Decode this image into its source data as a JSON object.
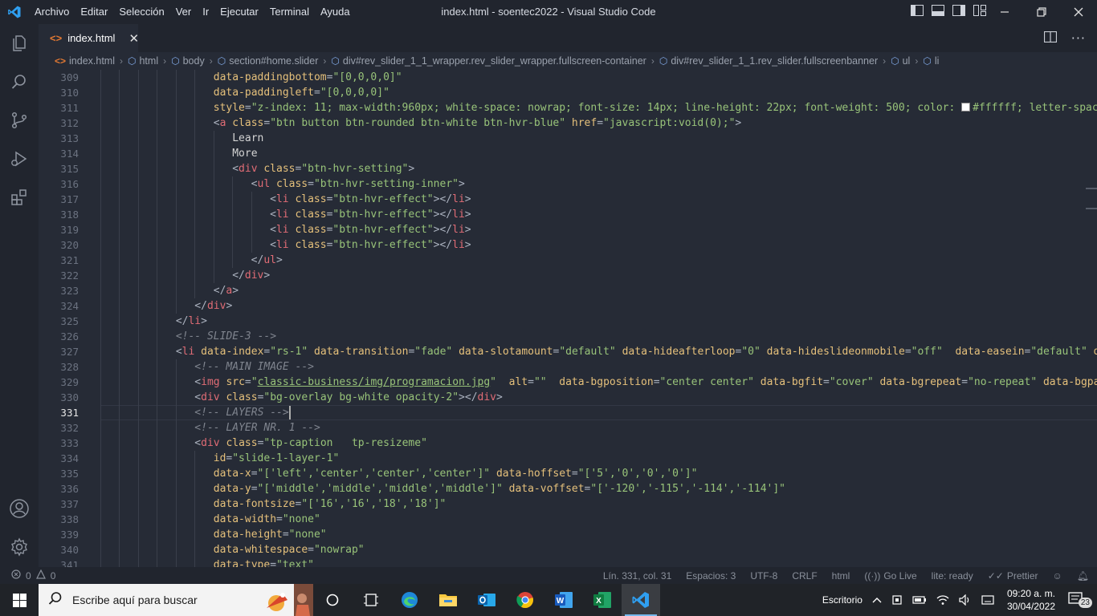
{
  "titlebar": {
    "menu": [
      "Archivo",
      "Editar",
      "Selección",
      "Ver",
      "Ir",
      "Ejecutar",
      "Terminal",
      "Ayuda"
    ],
    "window_title": "index.html - soentec2022 - Visual Studio Code"
  },
  "tab": {
    "label": "index.html",
    "icon_glyph": "<>"
  },
  "breadcrumb": [
    "index.html",
    "html",
    "body",
    "section#home.slider",
    "div#rev_slider_1_1_wrapper.rev_slider_wrapper.fullscreen-container",
    "div#rev_slider_1_1.rev_slider.fullscreenbanner",
    "ul",
    "li"
  ],
  "editor": {
    "first_line": 309,
    "active_line": 331,
    "lines": [
      [
        [
          "t-attr",
          "data-paddingbottom"
        ],
        [
          "t-brk",
          "="
        ],
        [
          "t-str",
          "\"[0,0,0,0]\""
        ]
      ],
      [
        [
          "t-attr",
          "data-paddingleft"
        ],
        [
          "t-brk",
          "="
        ],
        [
          "t-str",
          "\"[0,0,0,0]\""
        ]
      ],
      [
        [
          "t-attr",
          "style"
        ],
        [
          "t-brk",
          "="
        ],
        [
          "t-str",
          "\"z-index: 11; max-width:960px; white-space: nowrap; font-size: 14px; line-height: 22px; font-weight: 500; color: "
        ],
        [
          "swatch",
          ""
        ],
        [
          "t-str",
          "#ffffff; letter-spacing"
        ]
      ],
      [
        [
          "t-brk",
          "<"
        ],
        [
          "t-tag",
          "a"
        ],
        [
          "t-txt",
          " "
        ],
        [
          "t-attr",
          "class"
        ],
        [
          "t-brk",
          "="
        ],
        [
          "t-str",
          "\"btn button btn-rounded btn-white btn-hvr-blue\""
        ],
        [
          "t-txt",
          " "
        ],
        [
          "t-attr",
          "href"
        ],
        [
          "t-brk",
          "="
        ],
        [
          "t-str",
          "\"javascript:void(0);\""
        ],
        [
          "t-brk",
          ">"
        ]
      ],
      [
        [
          "t-txt",
          "Learn"
        ]
      ],
      [
        [
          "t-txt",
          "More"
        ]
      ],
      [
        [
          "t-brk",
          "<"
        ],
        [
          "t-tag",
          "div"
        ],
        [
          "t-txt",
          " "
        ],
        [
          "t-attr",
          "class"
        ],
        [
          "t-brk",
          "="
        ],
        [
          "t-str",
          "\"btn-hvr-setting\""
        ],
        [
          "t-brk",
          ">"
        ]
      ],
      [
        [
          "t-brk",
          "<"
        ],
        [
          "t-tag",
          "ul"
        ],
        [
          "t-txt",
          " "
        ],
        [
          "t-attr",
          "class"
        ],
        [
          "t-brk",
          "="
        ],
        [
          "t-str",
          "\"btn-hvr-setting-inner\""
        ],
        [
          "t-brk",
          ">"
        ]
      ],
      [
        [
          "t-brk",
          "<"
        ],
        [
          "t-tag",
          "li"
        ],
        [
          "t-txt",
          " "
        ],
        [
          "t-attr",
          "class"
        ],
        [
          "t-brk",
          "="
        ],
        [
          "t-str",
          "\"btn-hvr-effect\""
        ],
        [
          "t-brk",
          "></"
        ],
        [
          "t-tag",
          "li"
        ],
        [
          "t-brk",
          ">"
        ]
      ],
      [
        [
          "t-brk",
          "<"
        ],
        [
          "t-tag",
          "li"
        ],
        [
          "t-txt",
          " "
        ],
        [
          "t-attr",
          "class"
        ],
        [
          "t-brk",
          "="
        ],
        [
          "t-str",
          "\"btn-hvr-effect\""
        ],
        [
          "t-brk",
          "></"
        ],
        [
          "t-tag",
          "li"
        ],
        [
          "t-brk",
          ">"
        ]
      ],
      [
        [
          "t-brk",
          "<"
        ],
        [
          "t-tag",
          "li"
        ],
        [
          "t-txt",
          " "
        ],
        [
          "t-attr",
          "class"
        ],
        [
          "t-brk",
          "="
        ],
        [
          "t-str",
          "\"btn-hvr-effect\""
        ],
        [
          "t-brk",
          "></"
        ],
        [
          "t-tag",
          "li"
        ],
        [
          "t-brk",
          ">"
        ]
      ],
      [
        [
          "t-brk",
          "<"
        ],
        [
          "t-tag",
          "li"
        ],
        [
          "t-txt",
          " "
        ],
        [
          "t-attr",
          "class"
        ],
        [
          "t-brk",
          "="
        ],
        [
          "t-str",
          "\"btn-hvr-effect\""
        ],
        [
          "t-brk",
          "></"
        ],
        [
          "t-tag",
          "li"
        ],
        [
          "t-brk",
          ">"
        ]
      ],
      [
        [
          "t-brk",
          "</"
        ],
        [
          "t-tag",
          "ul"
        ],
        [
          "t-brk",
          ">"
        ]
      ],
      [
        [
          "t-brk",
          "</"
        ],
        [
          "t-tag",
          "div"
        ],
        [
          "t-brk",
          ">"
        ]
      ],
      [
        [
          "t-brk",
          "</"
        ],
        [
          "t-tag",
          "a"
        ],
        [
          "t-brk",
          ">"
        ]
      ],
      [
        [
          "t-brk",
          "</"
        ],
        [
          "t-tag",
          "div"
        ],
        [
          "t-brk",
          ">"
        ]
      ],
      [
        [
          "t-brk",
          "</"
        ],
        [
          "t-tag",
          "li"
        ],
        [
          "t-brk",
          ">"
        ]
      ],
      [
        [
          "t-cmt",
          "<!-- SLIDE-3 -->"
        ]
      ],
      [
        [
          "t-brk",
          "<"
        ],
        [
          "t-tag",
          "li"
        ],
        [
          "t-txt",
          " "
        ],
        [
          "t-attr",
          "data-index"
        ],
        [
          "t-brk",
          "="
        ],
        [
          "t-str",
          "\"rs-1\""
        ],
        [
          "t-txt",
          " "
        ],
        [
          "t-attr",
          "data-transition"
        ],
        [
          "t-brk",
          "="
        ],
        [
          "t-str",
          "\"fade\""
        ],
        [
          "t-txt",
          " "
        ],
        [
          "t-attr",
          "data-slotamount"
        ],
        [
          "t-brk",
          "="
        ],
        [
          "t-str",
          "\"default\""
        ],
        [
          "t-txt",
          " "
        ],
        [
          "t-attr",
          "data-hideafterloop"
        ],
        [
          "t-brk",
          "="
        ],
        [
          "t-str",
          "\"0\""
        ],
        [
          "t-txt",
          " "
        ],
        [
          "t-attr",
          "data-hideslideonmobile"
        ],
        [
          "t-brk",
          "="
        ],
        [
          "t-str",
          "\"off\""
        ],
        [
          "t-txt",
          "  "
        ],
        [
          "t-attr",
          "data-easein"
        ],
        [
          "t-brk",
          "="
        ],
        [
          "t-str",
          "\"default\""
        ],
        [
          "t-txt",
          " "
        ],
        [
          "t-attr",
          "data-ea"
        ]
      ],
      [
        [
          "t-cmt",
          "<!-- MAIN IMAGE -->"
        ]
      ],
      [
        [
          "t-brk",
          "<"
        ],
        [
          "t-tag",
          "img"
        ],
        [
          "t-txt",
          " "
        ],
        [
          "t-attr",
          "src"
        ],
        [
          "t-brk",
          "="
        ],
        [
          "t-str",
          "\""
        ],
        [
          "t-link",
          "classic-business/img/programacion.jpg"
        ],
        [
          "t-str",
          "\""
        ],
        [
          "t-txt",
          "  "
        ],
        [
          "t-attr",
          "alt"
        ],
        [
          "t-brk",
          "="
        ],
        [
          "t-str",
          "\"\""
        ],
        [
          "t-txt",
          "  "
        ],
        [
          "t-attr",
          "data-bgposition"
        ],
        [
          "t-brk",
          "="
        ],
        [
          "t-str",
          "\"center center\""
        ],
        [
          "t-txt",
          " "
        ],
        [
          "t-attr",
          "data-bgfit"
        ],
        [
          "t-brk",
          "="
        ],
        [
          "t-str",
          "\"cover\""
        ],
        [
          "t-txt",
          " "
        ],
        [
          "t-attr",
          "data-bgrepeat"
        ],
        [
          "t-brk",
          "="
        ],
        [
          "t-str",
          "\"no-repeat\""
        ],
        [
          "t-txt",
          " "
        ],
        [
          "t-attr",
          "data-bgparall"
        ]
      ],
      [
        [
          "t-brk",
          "<"
        ],
        [
          "t-tag",
          "div"
        ],
        [
          "t-txt",
          " "
        ],
        [
          "t-attr",
          "class"
        ],
        [
          "t-brk",
          "="
        ],
        [
          "t-str",
          "\"bg-overlay bg-white opacity-2\""
        ],
        [
          "t-brk",
          "></"
        ],
        [
          "t-tag",
          "div"
        ],
        [
          "t-brk",
          ">"
        ]
      ],
      [
        [
          "t-cmt",
          "<!-- LAYERS -->"
        ],
        [
          "cursor",
          ""
        ]
      ],
      [
        [
          "t-cmt",
          "<!-- LAYER NR. 1 -->"
        ]
      ],
      [
        [
          "t-brk",
          "<"
        ],
        [
          "t-tag",
          "div"
        ],
        [
          "t-txt",
          " "
        ],
        [
          "t-attr",
          "class"
        ],
        [
          "t-brk",
          "="
        ],
        [
          "t-str",
          "\"tp-caption   tp-resizeme\""
        ]
      ],
      [
        [
          "t-attr",
          "id"
        ],
        [
          "t-brk",
          "="
        ],
        [
          "t-str",
          "\"slide-1-layer-1\""
        ]
      ],
      [
        [
          "t-attr",
          "data-x"
        ],
        [
          "t-brk",
          "="
        ],
        [
          "t-str",
          "\"['left','center','center','center']\""
        ],
        [
          "t-txt",
          " "
        ],
        [
          "t-attr",
          "data-hoffset"
        ],
        [
          "t-brk",
          "="
        ],
        [
          "t-str",
          "\"['5','0','0','0']\""
        ]
      ],
      [
        [
          "t-attr",
          "data-y"
        ],
        [
          "t-brk",
          "="
        ],
        [
          "t-str",
          "\"['middle','middle','middle','middle']\""
        ],
        [
          "t-txt",
          " "
        ],
        [
          "t-attr",
          "data-voffset"
        ],
        [
          "t-brk",
          "="
        ],
        [
          "t-str",
          "\"['-120','-115','-114','-114']\""
        ]
      ],
      [
        [
          "t-attr",
          "data-fontsize"
        ],
        [
          "t-brk",
          "="
        ],
        [
          "t-str",
          "\"['16','16','18','18']\""
        ]
      ],
      [
        [
          "t-attr",
          "data-width"
        ],
        [
          "t-brk",
          "="
        ],
        [
          "t-str",
          "\"none\""
        ]
      ],
      [
        [
          "t-attr",
          "data-height"
        ],
        [
          "t-brk",
          "="
        ],
        [
          "t-str",
          "\"none\""
        ]
      ],
      [
        [
          "t-attr",
          "data-whitespace"
        ],
        [
          "t-brk",
          "="
        ],
        [
          "t-str",
          "\"nowrap\""
        ]
      ],
      [
        [
          "t-attr",
          "data-type"
        ],
        [
          "t-brk",
          "="
        ],
        [
          "t-str",
          "\"text\""
        ]
      ]
    ],
    "indents": [
      6,
      6,
      6,
      6,
      7,
      7,
      7,
      8,
      9,
      9,
      9,
      9,
      8,
      7,
      6,
      5,
      4,
      4,
      4,
      5,
      5,
      5,
      5,
      5,
      5,
      6,
      6,
      6,
      6,
      6,
      6,
      6,
      6
    ]
  },
  "statusbar": {
    "errors": "0",
    "warnings": "0",
    "position": "Lín. 331, col. 31",
    "spaces": "Espacios: 3",
    "encoding": "UTF-8",
    "eol": "CRLF",
    "language": "html",
    "golive": "Go Live",
    "lite": "lite: ready",
    "prettier": "Prettier"
  },
  "taskbar": {
    "search_placeholder": "Escribe aquí para buscar",
    "desktop_label": "Escritorio",
    "time": "09:20 a. m.",
    "date": "30/04/2022",
    "notifications": "23"
  },
  "colors": {
    "accent": "#007acc",
    "editor_bg": "#262b36",
    "chrome_bg": "#21252e"
  }
}
